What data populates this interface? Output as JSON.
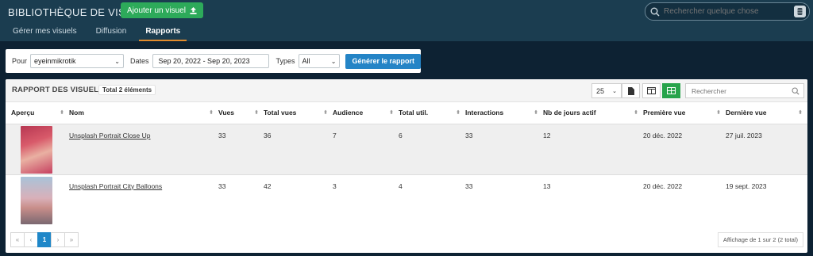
{
  "header": {
    "title": "BIBLIOTHÈQUE DE VISUELS",
    "add_button": "Ajouter un visuel",
    "search_placeholder": "Rechercher quelque chose",
    "tabs": [
      {
        "label": "Gérer mes visuels",
        "active": false
      },
      {
        "label": "Diffusion",
        "active": false
      },
      {
        "label": "Rapports",
        "active": true
      }
    ]
  },
  "filters": {
    "pour_label": "Pour",
    "pour_value": "eyeinmikrotik",
    "dates_label": "Dates",
    "dates_value": "Sep 20, 2022 - Sep 20, 2023",
    "types_label": "Types",
    "types_value": "All",
    "generate_button": "Générer le rapport"
  },
  "report": {
    "title": "RAPPORT DES VISUELS",
    "total_badge": "Total 2 éléments",
    "per_page": "25",
    "search_placeholder": "Rechercher",
    "columns": [
      "Aperçu",
      "Nom",
      "Vues",
      "Total vues",
      "Audience",
      "Total util.",
      "Interactions",
      "Nb de jours actif",
      "Première vue",
      "Dernière vue"
    ],
    "rows": [
      {
        "name": "Unsplash Portrait Close Up",
        "vues": "33",
        "total_vues": "36",
        "audience": "7",
        "total_util": "6",
        "interactions": "33",
        "jours_actif": "12",
        "premiere_vue": "20 déc. 2022",
        "derniere_vue": "27 juil. 2023"
      },
      {
        "name": "Unsplash Portrait City Balloons",
        "vues": "33",
        "total_vues": "42",
        "audience": "3",
        "total_util": "4",
        "interactions": "33",
        "jours_actif": "13",
        "premiere_vue": "20 déc. 2022",
        "derniere_vue": "19 sept. 2023"
      }
    ],
    "pagination": {
      "first": "«",
      "prev": "‹",
      "current": "1",
      "next": "›",
      "last": "»",
      "info": "Affichage de 1 sur 2 (2 total)"
    }
  },
  "colors": {
    "background": "#0d2233",
    "header": "#1b3d50",
    "add_button": "#2daa5a",
    "tab_underline": "#e08a2c",
    "generate_button": "#2484c6",
    "active_page": "#1f87c8",
    "grid_toggle": "#27a34b"
  }
}
